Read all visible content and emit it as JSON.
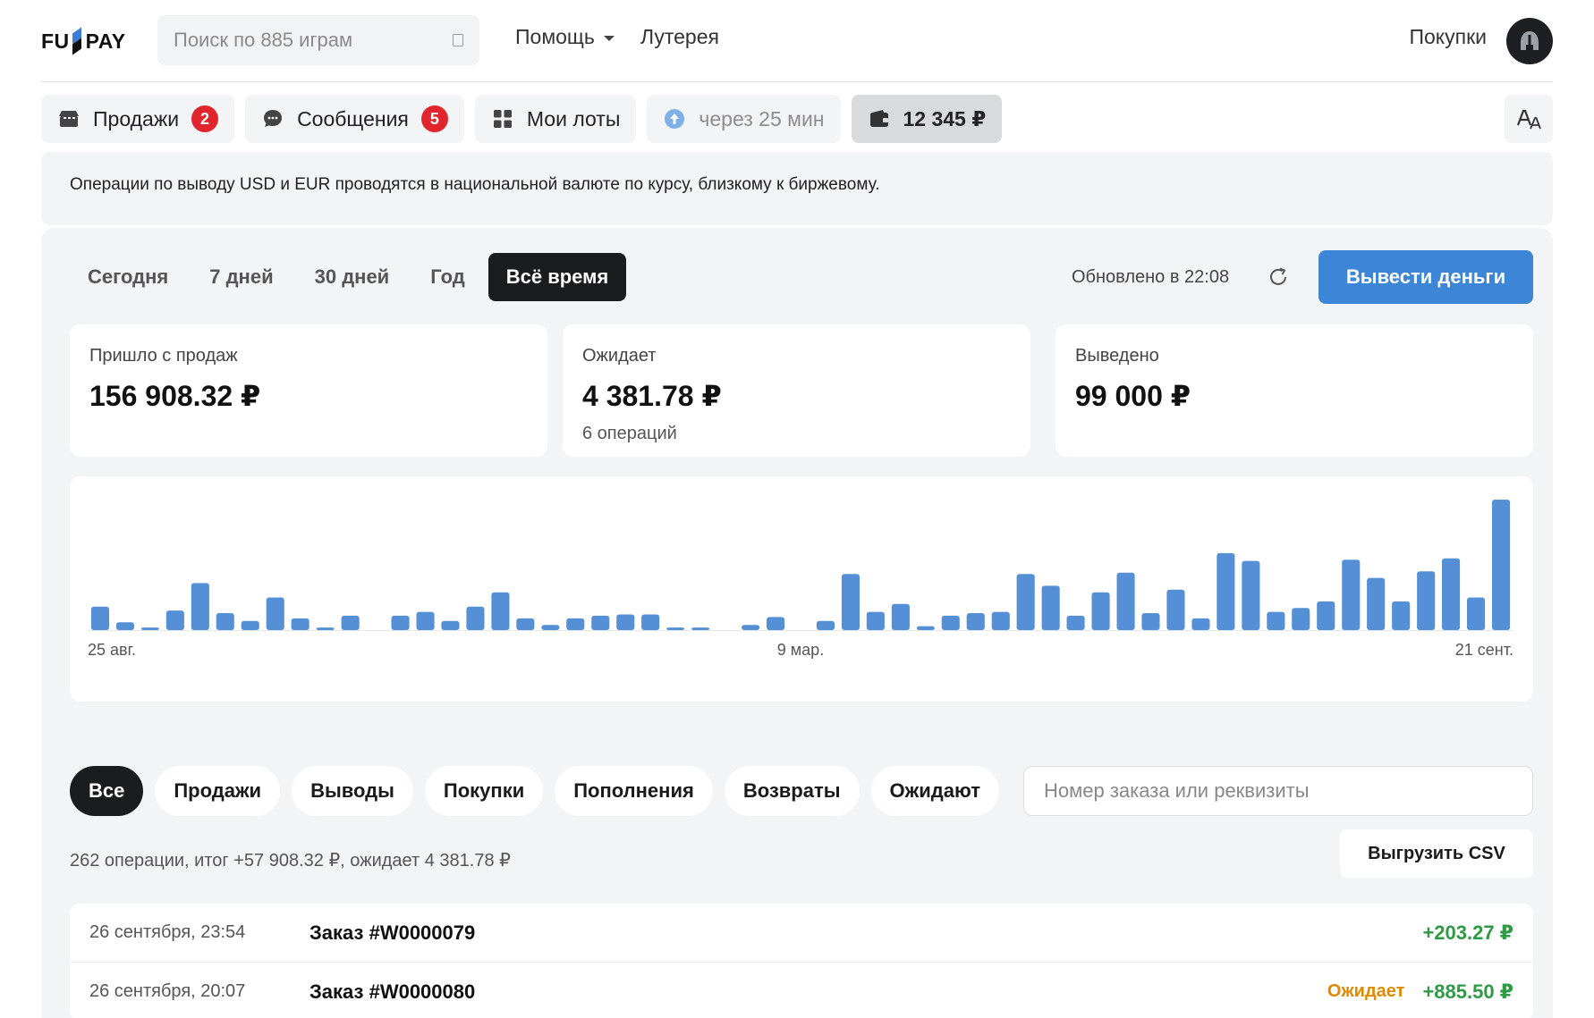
{
  "header": {
    "logo_left": "FU",
    "logo_right": "PAY",
    "search_placeholder": "Поиск по 885 играм",
    "nav_help": "Помощь",
    "nav_lottery": "Лутерея",
    "purchases": "Покупки",
    "avatar_icon": "helmet-icon"
  },
  "tabs": [
    {
      "label": "Продажи",
      "badge": "2",
      "icon": "shop-icon"
    },
    {
      "label": "Сообщения",
      "badge": "5",
      "icon": "chat-icon"
    },
    {
      "label": "Мои лоты",
      "icon": "grid-icon"
    },
    {
      "label": "через 25 мин",
      "icon": "arrow-up-icon"
    },
    {
      "label": "12 345 ₽",
      "icon": "wallet-icon"
    }
  ],
  "lang_icon": "translate-icon",
  "notice": "Операции по выводу USD и EUR проводятся в национальной валюте по курсу, близкому к биржевому.",
  "periods": [
    "Сегодня",
    "7 дней",
    "30 дней",
    "Год",
    "Всё время"
  ],
  "active_period": "Всё время",
  "updated": "Обновлено в 22:08",
  "withdraw_label": "Вывести деньги",
  "stats": {
    "incoming": {
      "label": "Пришло с продаж",
      "value": "156 908.32 ₽"
    },
    "pending": {
      "label": "Ожидает",
      "value": "4 381.78 ₽",
      "sub": "6 операций"
    },
    "withdrawn": {
      "label": "Выведено",
      "value": "99 000 ₽"
    }
  },
  "chart_data": {
    "type": "bar",
    "x_tick_labels": [
      "25 авг.",
      "9 мар.",
      "21 сент."
    ],
    "values": [
      18,
      6,
      2,
      15,
      36,
      13,
      7,
      25,
      9,
      2,
      11,
      0,
      11,
      14,
      7,
      18,
      29,
      9,
      4,
      9,
      11,
      12,
      12,
      2,
      2,
      0,
      4,
      10,
      0,
      7,
      43,
      14,
      20,
      3,
      11,
      13,
      14,
      43,
      34,
      11,
      29,
      44,
      13,
      31,
      9,
      59,
      53,
      14,
      17,
      22,
      54,
      40,
      22,
      45,
      55,
      25,
      100
    ],
    "color": "#5590d6"
  },
  "filters": [
    "Все",
    "Продажи",
    "Выводы",
    "Покупки",
    "Пополнения",
    "Возвраты",
    "Ожидают"
  ],
  "active_filter": "Все",
  "order_search_placeholder": "Номер заказа или реквизиты",
  "summary": "262 операции, итог +57 908.32 ₽, ожидает 4 381.78 ₽",
  "csv_label": "Выгрузить CSV",
  "operations": [
    {
      "date": "26 сентября, 23:54",
      "title": "Заказ #W0000079",
      "status": "",
      "amount": "+203.27 ₽"
    },
    {
      "date": "26 сентября, 20:07",
      "title": "Заказ #W0000080",
      "status": "Ожидает",
      "amount": "+885.50 ₽"
    }
  ],
  "colors": {
    "accent": "#3d85d6",
    "badge": "#e0262c",
    "positive": "#2f9a44",
    "pending": "#e08a00"
  }
}
